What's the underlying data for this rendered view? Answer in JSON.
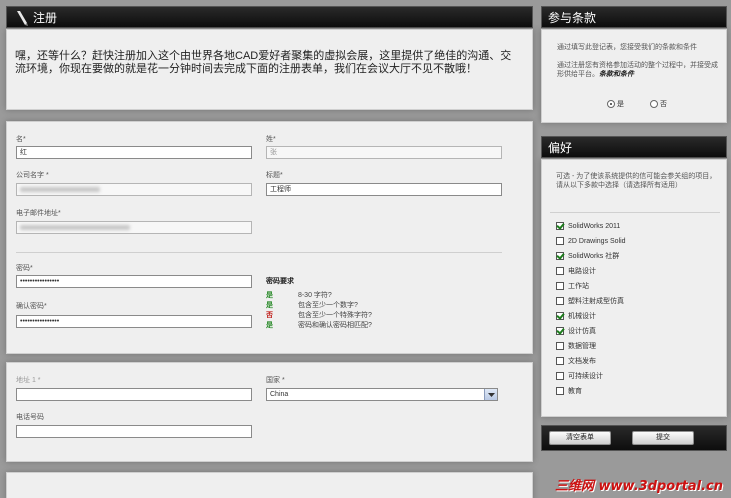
{
  "register": {
    "title": "注册",
    "intro": "嘿，还等什么？赶快注册加入这个由世界各地CAD爱好者聚集的虚拟会展，这里提供了绝佳的沟通、交流环境，你现在要做的就是花一分钟时间去完成下面的注册表单，我们在会议大厅不见不散哦！"
  },
  "form": {
    "first_name_label": "名*",
    "first_name_value": "红",
    "last_name_label": "姓*",
    "last_name_value": "张",
    "company_label": "公司名字 *",
    "title_label": "标题*",
    "title_value": "工程师",
    "email_label": "电子邮件地址*",
    "password_label": "密码*",
    "password_value": "••••••••••••••••",
    "confirm_label": "确认密码*",
    "confirm_value": "••••••••••••••••"
  },
  "password_rules": {
    "heading": "密码要求",
    "items": [
      {
        "status": "是",
        "text": "8-30 字符?"
      },
      {
        "status": "是",
        "text": "包含至少一个数字?"
      },
      {
        "status": "否",
        "text": "包含至少一个特殊字符?"
      },
      {
        "status": "是",
        "text": "密码和确认密码相匹配?"
      }
    ]
  },
  "address": {
    "address1_label": "地址 1 *",
    "country_label": "国家 *",
    "country_value": "China",
    "phone_label": "电话号码"
  },
  "terms": {
    "title": "参与条款",
    "text1": "通过填写此登记表，您接受我们的条款和条件",
    "text2": "通过注册您有资格参加活动的整个过程中，并接受成形供给平台。",
    "text2_bold": "条款和条件",
    "yes_label": "是",
    "no_label": "否"
  },
  "preferences": {
    "title": "偏好",
    "description": "可选 - 为了使该系统提供的信可能会参关组的项目，请从以下多款中选择（请选择所有适用）",
    "items": [
      {
        "label": "SolidWorks 2011",
        "checked": true
      },
      {
        "label": "2D Drawings Solid",
        "checked": false
      },
      {
        "label": "SolidWorks 社群",
        "checked": true
      },
      {
        "label": "电路设计",
        "checked": false
      },
      {
        "label": "工作站",
        "checked": false
      },
      {
        "label": "塑料注射成型仿真",
        "checked": false
      },
      {
        "label": "机械设计",
        "checked": true
      },
      {
        "label": "设计仿真",
        "checked": true
      },
      {
        "label": "数据管理",
        "checked": false
      },
      {
        "label": "文档发布",
        "checked": false
      },
      {
        "label": "可持续设计",
        "checked": false
      },
      {
        "label": "教育",
        "checked": false
      }
    ]
  },
  "buttons": {
    "clear": "清空表单",
    "submit": "提交"
  },
  "watermark": "三维网 www.3dportal.cn",
  "colors": {
    "status_yes": "#2a8a2a",
    "status_no": "#c0201c",
    "watermark": "#cc1111"
  }
}
